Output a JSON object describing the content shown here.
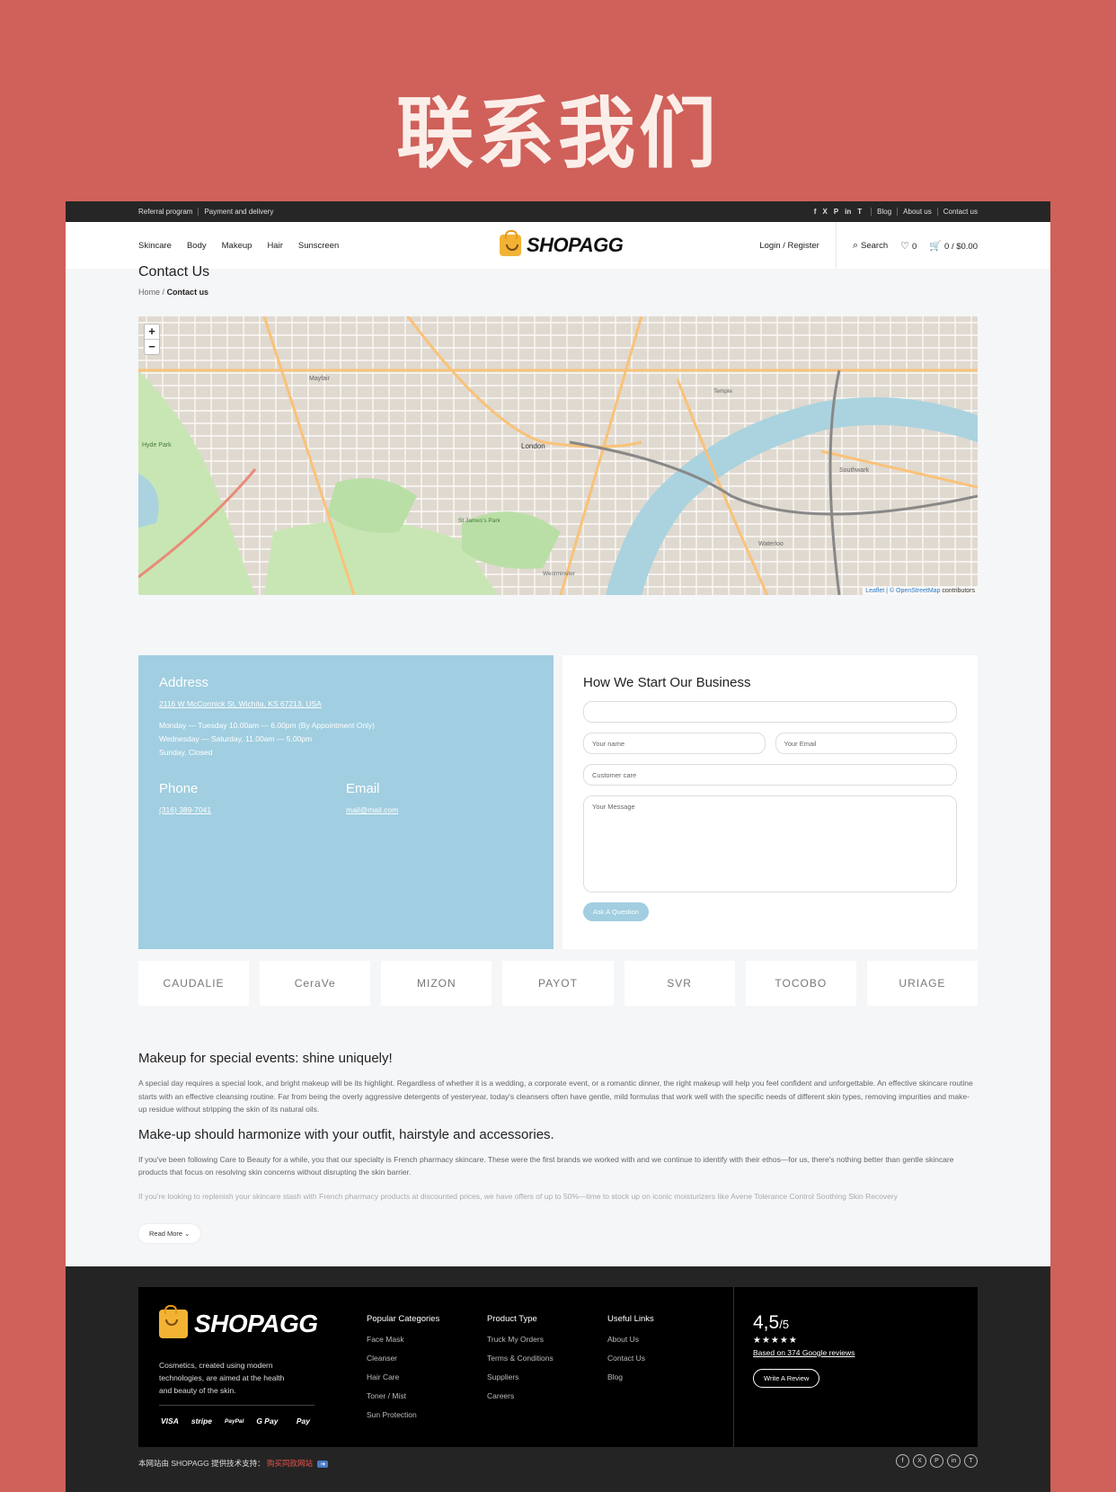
{
  "hero_title": "联系我们",
  "topbar": {
    "left": [
      "Referral program",
      "Payment and delivery"
    ],
    "social": [
      "f",
      "X",
      "P",
      "in",
      "T"
    ],
    "right": [
      "Blog",
      "About us",
      "Contact us"
    ]
  },
  "nav": {
    "menu": [
      "Skincare",
      "Body",
      "Makeup",
      "Hair",
      "Sunscreen"
    ],
    "logo": "SHOPAGG",
    "login": "Login / Register",
    "search": "Search",
    "wishlist_count": "0",
    "cart": "0 / $0.00"
  },
  "page": {
    "title": "Contact Us",
    "breadcrumb_home": "Home",
    "breadcrumb_sep": "/",
    "breadcrumb_current": "Contact us"
  },
  "map": {
    "zoom_in": "+",
    "zoom_out": "−",
    "labels": [
      "London",
      "Mayfair",
      "Hyde Park",
      "St James's Park",
      "Southwark",
      "Waterloo",
      "Westminster",
      "Temple"
    ],
    "attribution_prefix": "Leaflet",
    "attribution_sep": " | © ",
    "attribution_osm": "OpenStreetMap",
    "attribution_suffix": " contributors"
  },
  "address_block": {
    "address_heading": "Address",
    "address_link": "2116 W McCormick St, Wichita, KS 67213, USA",
    "hours": [
      "Monday — Tuesday 10.00am — 6.00pm (By Appointment Only)",
      "Wednesday — Saturday, 11.00am — 5.00pm",
      "Sunday, Closed"
    ],
    "phone_heading": "Phone",
    "phone": "(316) 389-7041",
    "email_heading": "Email",
    "email": "mail@mail.com"
  },
  "form": {
    "heading": "How We Start Our Business",
    "top_value": "",
    "name_placeholder": "Your name",
    "email_placeholder": "Your Email",
    "subject_value": "Customer care",
    "message_placeholder": "Your Message",
    "submit": "Ask A Question"
  },
  "brands": [
    "CAUDALIE",
    "CeraVe",
    "MIZON",
    "PAYOT",
    "SVR",
    "TOCOBO",
    "URIAGE"
  ],
  "seo": {
    "h1": "Makeup for special events: shine uniquely!",
    "p1": "A special day requires a special look, and bright makeup will be its highlight. Regardless of whether it is a wedding, a corporate event, or a romantic dinner, the right makeup will help you feel confident and unforgettable. An effective skincare routine starts with an effective cleansing routine. Far from being the overly aggressive detergents of yesteryear, today's cleansers often have gentle, mild formulas that work well with the specific needs of different skin types, removing impurities and make-up residue without stripping the skin of its natural oils.",
    "h2": "Make-up should harmonize with your outfit, hairstyle and accessories.",
    "p2": "If you've been following Care to Beauty for a while, you that our specialty is French pharmacy skincare. These were the first brands we worked with and we continue to identify with their ethos—for us, there's nothing better than gentle skincare products that focus on resolving skin concerns without disrupting the skin barrier.",
    "p3": "If you're looking to replenish your skincare stash with French pharmacy products at discounted prices, we have offers of up to 50%—time to stock up on iconic moisturizers like Avene Tolerance Control Soothing Skin Recovery",
    "read_more": "Read More ⌄"
  },
  "footer": {
    "logo": "SHOPAGG",
    "description": "Cosmetics, created using modern technologies, are aimed at the health and beauty of the skin.",
    "payments": [
      "VISA",
      "stripe",
      "PayPal",
      "G Pay",
      "Pay"
    ],
    "col1": {
      "title": "Popular Categories",
      "items": [
        "Face Mask",
        "Cleanser",
        "Hair Care",
        "Toner / Mist",
        "Sun Protection"
      ]
    },
    "col2": {
      "title": "Product Type",
      "items": [
        "Truck My Orders",
        "Terms & Conditions",
        "Suppliers",
        "Careers"
      ]
    },
    "col3": {
      "title": "Useful Links",
      "items": [
        "About Us",
        "Contact Us",
        "Blog"
      ]
    },
    "rating_value": "4,5",
    "rating_max": "/5",
    "stars": "★★★★★",
    "reviews": "Based on 374 Google reviews",
    "write_review": "Write A Review",
    "bottom_text": "本网站由 SHOPAGG 提供技术支持：",
    "bottom_link": "购买同款网站",
    "bottom_arrow": "➔",
    "social": [
      "f",
      "X",
      "P",
      "in",
      "T"
    ]
  }
}
